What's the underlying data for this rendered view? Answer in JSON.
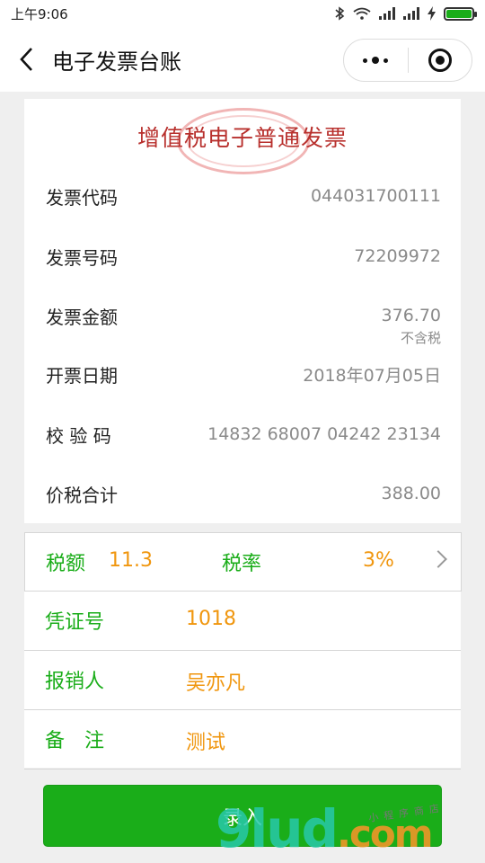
{
  "status_bar": {
    "time": "上午9:06"
  },
  "nav": {
    "title": "电子发票台账"
  },
  "invoice": {
    "title": "增值税电子普通发票",
    "rows": [
      {
        "label": "发票代码",
        "value": "044031700111"
      },
      {
        "label": "发票号码",
        "value": "72209972"
      },
      {
        "label": "发票金额",
        "value": "376.70",
        "sub": "不含税"
      },
      {
        "label": "开票日期",
        "value": "2018年07月05日"
      },
      {
        "label": "校 验 码",
        "value": "14832 68007 04242 23134"
      },
      {
        "label": "价税合计",
        "value": "388.00"
      }
    ]
  },
  "details": {
    "tax_amount_label": "税额",
    "tax_amount_value": "11.3",
    "tax_rate_label": "税率",
    "tax_rate_value": "3%",
    "voucher_label": "凭证号",
    "voucher_value": "1018",
    "reimburser_label": "报销人",
    "reimburser_value": "吴亦凡",
    "note_label": "备　注",
    "note_value": "测试"
  },
  "submit": {
    "label": "录入"
  },
  "watermark": {
    "brand": "9lud",
    "suffix": ".com",
    "tagline": "小程序商店"
  },
  "colors": {
    "accent_green": "#1aad19",
    "value_orange": "#f0960e",
    "invoice_red": "#b8302d"
  }
}
